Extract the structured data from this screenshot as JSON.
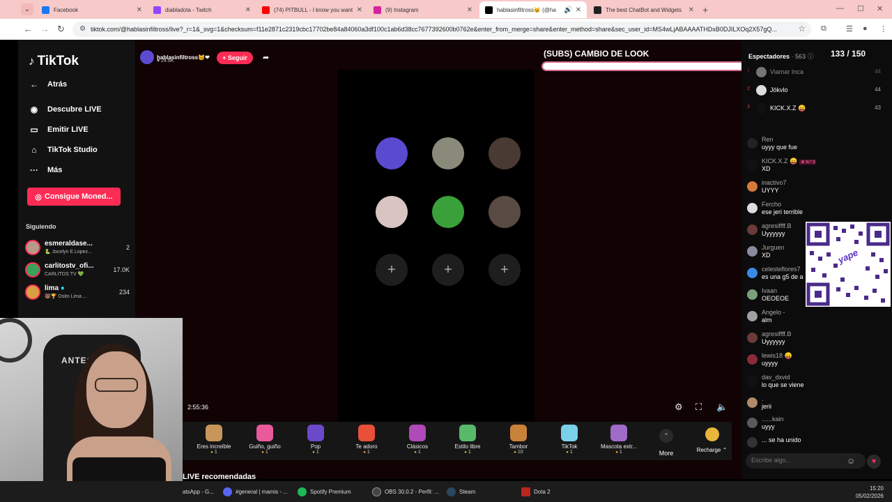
{
  "browser": {
    "tabs": [
      {
        "title": "Facebook",
        "favicon_color": "#1877f2"
      },
      {
        "title": "diabladota - Twitch",
        "favicon_color": "#9146ff"
      },
      {
        "title": "(74) PITBULL - I know you want",
        "favicon_color": "#ff0000"
      },
      {
        "title": "(9) Instagram",
        "favicon_color": "#d6249f"
      },
      {
        "title": "hablasinfiltross😼 (@ha",
        "favicon_color": "#000000"
      },
      {
        "title": "The best ChatBot and Widgets",
        "favicon_color": "#222222"
      }
    ],
    "url": "tiktok.com/@hablasinfiltross/live?_r=1&_svg=1&checksum=f11e2871c2319cbc17702be84a84060a3df100c1ab6d38cc7677392600b0762e&enter_from_merge=share&enter_method=share&sec_user_id=MS4wLjABAAAATHDxB0DJILXOq2X57gQ..."
  },
  "sidebar": {
    "logo": "TikTok",
    "back": "Atrás",
    "items": [
      {
        "label": "Descubre LIVE"
      },
      {
        "label": "Emitir LIVE"
      },
      {
        "label": "TikTok Studio"
      },
      {
        "label": "Más"
      }
    ],
    "coins_button": "Consigue Moned...",
    "following_heading": "Siguiendo",
    "following": [
      {
        "name": "esmeraldase...",
        "sub": "🐍 Jocelyn E.Lopez...",
        "count": "2"
      },
      {
        "name": "carlitostv_ofi...",
        "sub": "CARLITOS TV 💚",
        "count": "17.0K"
      },
      {
        "name": "lima",
        "sub": "🐻🏆 Osito Lima ...",
        "count": "234"
      }
    ]
  },
  "live": {
    "host_name": "hablasinfiltross😼❤",
    "host_likes": "♥ 24.6K",
    "follow_button": "+ Seguir",
    "goal_title": "(SUBS) CAMBIO DE LOOK",
    "goal_current": "133",
    "goal_total": "/ 150",
    "goal_progress": 0.887,
    "seat_add_symbol": "+",
    "timer": "2:55:36",
    "gifts": [
      {
        "name": "Eres increíble",
        "price": "1",
        "color": "#c8965a"
      },
      {
        "name": "Guiño, guiño",
        "price": "1",
        "color": "#e85a9a"
      },
      {
        "name": "Pop",
        "price": "1",
        "color": "#6a4ac8"
      },
      {
        "name": "Te adoro",
        "price": "1",
        "color": "#e8503a"
      },
      {
        "name": "Clásicos",
        "price": "1",
        "color": "#b04ab8"
      },
      {
        "name": "Estilo libre",
        "price": "1",
        "color": "#5ab86a"
      },
      {
        "name": "Tambor",
        "price": "10",
        "color": "#c8823a"
      },
      {
        "name": "TikTok",
        "price": "1",
        "color": "#7ad0e8"
      },
      {
        "name": "Mascota extr...",
        "price": "1",
        "color": "#a06ac8"
      }
    ],
    "more_label": "More",
    "recharge_label": "Recharge",
    "recommended": "LIVE recomendadas"
  },
  "panel": {
    "viewers_label": "Espectadores",
    "viewers_count": "· 563",
    "ranking": [
      {
        "rank": "1",
        "name": "Viamar Inca",
        "score": "44"
      },
      {
        "rank": "2",
        "name": "Jökvlo",
        "score": "44"
      },
      {
        "rank": "3",
        "name": "KICK.X.Z 😛",
        "score": "43"
      }
    ],
    "chat": [
      {
        "user": "Ren",
        "text": "uyyy que fue",
        "color": "#222222"
      },
      {
        "user": "KICK.X.Z 😛",
        "badge": "♛ N.º 3",
        "text": "XD",
        "color": "#111111"
      },
      {
        "user": "inactivo7",
        "text": "UYYY",
        "color": "#d67a3a"
      },
      {
        "user": "Fercho",
        "text": "ese jeri terrible",
        "color": "#dddddd"
      },
      {
        "user": "agresiffff.B",
        "text": "Uyyyyyy",
        "color": "#6a3a3a"
      },
      {
        "user": "Jurguen",
        "text": "XD",
        "color": "#8a8aa0"
      },
      {
        "user": "celesteflores7",
        "text": "es una g5 de a",
        "color": "#3a8ae8"
      },
      {
        "user": "Ivaan",
        "text": "OEOEOE",
        "color": "#7aa07a"
      },
      {
        "user": "Angelo -",
        "text": "alm",
        "color": "#a0a0a0"
      },
      {
        "user": "agresiffff.B",
        "text": "Uyyyyyy",
        "color": "#6a3a3a"
      },
      {
        "user": "lewis18 😛",
        "text": "uyyyy",
        "color": "#8a2a3a"
      },
      {
        "user": "dav_dxvid",
        "text": "lo que se viene",
        "color": "#111111"
      },
      {
        "user": ".",
        "text": "jerii",
        "color": "#b08a6a"
      },
      {
        "user": "......kain",
        "text": "uyyy",
        "color": "#5a5a5a"
      },
      {
        "user": "",
        "text": "... se ha unido",
        "color": "#333333"
      }
    ],
    "qr_label": "yape",
    "chat_placeholder": "Escribe algo..."
  },
  "webcam": {
    "chair_brand": "ANTEC"
  },
  "taskbar": {
    "items": [
      {
        "label": "atsApp - G...",
        "color": "#25d366"
      },
      {
        "label": "#general | mamis - ...",
        "color": "#5865f2"
      },
      {
        "label": "Spotify Premium",
        "color": "#1db954"
      },
      {
        "label": "OBS 30.0.2 - Perfil: ...",
        "color": "#444444"
      },
      {
        "label": "Steam",
        "color": "#1b2838"
      },
      {
        "label": "Dota 2",
        "color": "#b8261c"
      }
    ],
    "time": "15:20",
    "date": "05/02/2026"
  }
}
